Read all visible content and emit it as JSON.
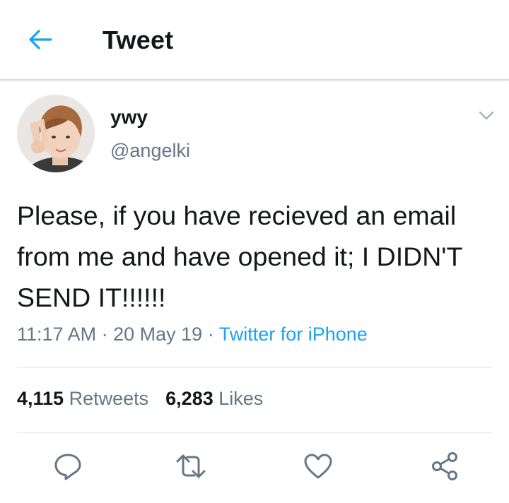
{
  "header": {
    "title": "Tweet",
    "back_icon": "arrow-left-icon"
  },
  "tweet": {
    "display_name": "ywy",
    "handle": "@angelki",
    "text": "Please, if you have recieved an email from me and have opened it; I DIDN'T SEND IT!!!!!!",
    "time": "11:17 AM",
    "date": "20 May 19",
    "source": "Twitter for iPhone",
    "separator": "·"
  },
  "stats": {
    "retweets_count": "4,115",
    "retweets_label": "Retweets",
    "likes_count": "6,283",
    "likes_label": "Likes"
  },
  "actions": [
    "reply-icon",
    "retweet-icon",
    "like-icon",
    "share-icon"
  ],
  "colors": {
    "accent": "#1da1f2",
    "muted": "#657786",
    "text": "#14171a",
    "divider": "#e1e8ed"
  }
}
